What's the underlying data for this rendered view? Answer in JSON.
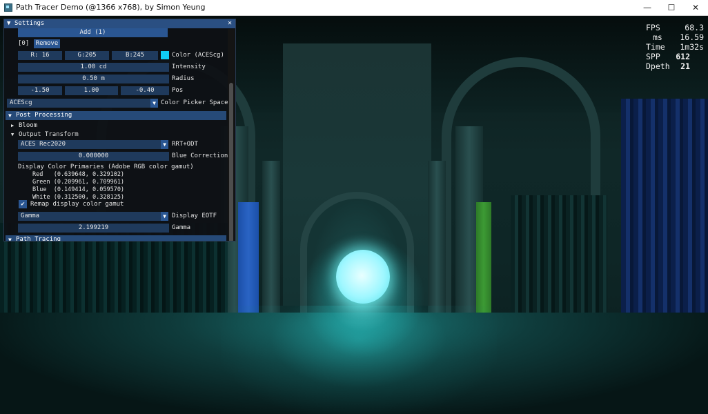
{
  "window": {
    "title": "Path Tracer Demo (@1366 x768), by Simon Yeung",
    "minimize": "—",
    "maximize": "☐",
    "close": "✕"
  },
  "stats": {
    "fps_label": "FPS",
    "fps_value": "68.3",
    "ms_label": "ms",
    "ms_value": "16.59",
    "time_label": "Time",
    "time_value": "1m32s",
    "spp_label": "SPP",
    "spp_value": "612",
    "depth_label": "Dpeth",
    "depth_value": "21"
  },
  "settings": {
    "title": "Settings",
    "collapse_glyph": "▼",
    "close_glyph": "✕",
    "add_button": "Add (1)",
    "light_index": "[0]",
    "remove_button": "Remove",
    "color": {
      "r": "R: 16",
      "g": "G:205",
      "b": "B:245",
      "swatch": "#10cdf5",
      "label": "Color (ACEScg)"
    },
    "intensity": {
      "value": "1.00 cd",
      "label": "Intensity"
    },
    "radius": {
      "value": "0.50 m",
      "label": "Radius"
    },
    "pos": {
      "x": "-1.50",
      "y": "1.00",
      "z": "-0.40",
      "label": "Pos"
    },
    "color_picker_space": {
      "value": "ACEScg",
      "label": "Color Picker Space"
    },
    "post_processing": {
      "label": "Post Processing",
      "bloom": "Bloom",
      "output_transform": "Output Transform",
      "rrt_odt": {
        "value": "ACES Rec2020",
        "label": "RRT+ODT"
      },
      "blue_correction": {
        "value": "0.000000",
        "label": "Blue Correction"
      },
      "primaries_header": "Display Color Primaries (Adobe RGB color gamut)",
      "primaries": [
        "Red   (0.639648, 0.329102)",
        "Green (0.209961, 0.709961)",
        "Blue  (0.149414, 0.059570)",
        "White (0.312500, 0.328125)"
      ],
      "remap_label": "Remap display color gamut",
      "remap_checked": "✔",
      "display_eotf": {
        "value": "Gamma",
        "label": "Display EOTF"
      },
      "gamma": {
        "value": "2.199219",
        "label": "Gamma"
      }
    },
    "path_tracing": {
      "label": "Path Tracing"
    },
    "glyphs": {
      "down": "▼",
      "right": "▶"
    }
  }
}
